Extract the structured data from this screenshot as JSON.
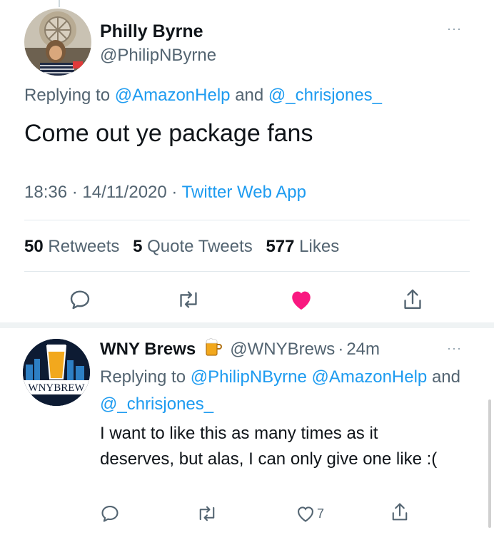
{
  "main_tweet": {
    "name": "Philly Byrne",
    "handle": "@PhilipNByrne",
    "replying_prefix": "Replying to",
    "replying_to_1": "@AmazonHelp",
    "replying_and": "and",
    "replying_to_2": "@_chrisjones_",
    "text": "Come out ye package fans",
    "time": "18:36",
    "date": "14/11/2020",
    "source": "Twitter Web App",
    "separator": "·",
    "stats": {
      "retweets_count": "50",
      "retweets_label": "Retweets",
      "quotes_count": "5",
      "quotes_label": "Quote Tweets",
      "likes_count": "577",
      "likes_label": "Likes"
    },
    "more_label": "···"
  },
  "reply_tweet": {
    "name": "WNY Brews",
    "handle": "@WNYBrews",
    "separator": "·",
    "age": "24m",
    "replying_prefix": "Replying to",
    "replying_to_1": "@PhilipNByrne",
    "replying_to_2": "@AmazonHelp",
    "replying_and": "and",
    "replying_to_3": "@_chrisjones_",
    "text": "I want to like this as many times as it deserves, but alas, I can only give one like :(",
    "like_count": "7",
    "avatar_text": "WNYBREW",
    "more_label": "···"
  },
  "colors": {
    "link": "#1d9bf0",
    "secondary_text": "#536471",
    "like_red": "#f91880",
    "icon_gray": "#536471"
  },
  "icons": [
    "reply-icon",
    "retweet-icon",
    "like-icon",
    "share-icon",
    "more-icon",
    "beer-icon"
  ]
}
